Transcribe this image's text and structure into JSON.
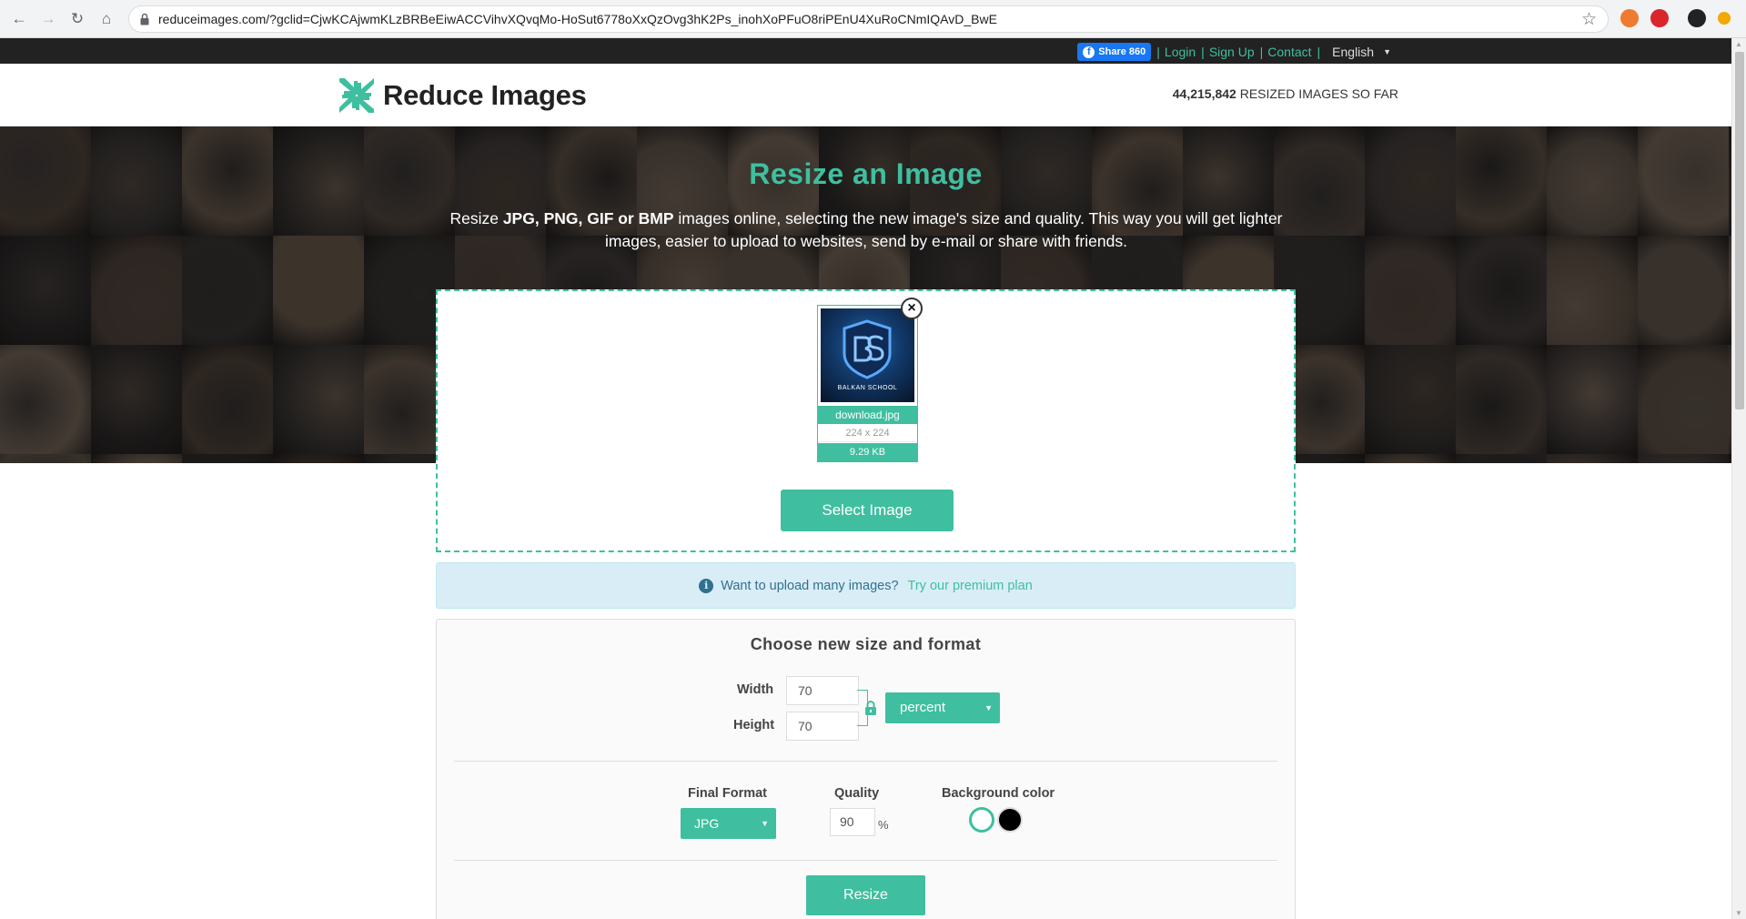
{
  "browser": {
    "url": "reduceimages.com/?gclid=CjwKCAjwmKLzBRBeEiwACCVihvXQvqMo-HoSut6778oXxQzOvg3hK2Ps_inohXoPFuO8riPEnU4XuRoCNmIQAvD_BwE",
    "icons": [
      "back-icon",
      "forward-icon",
      "reload-icon",
      "home-icon",
      "lock-icon",
      "star-icon"
    ]
  },
  "topbar": {
    "share_label": "Share 860",
    "login": "Login",
    "signup": "Sign Up",
    "contact": "Contact",
    "language": "English"
  },
  "header": {
    "logo_text": "Reduce Images",
    "counter_value": "44,215,842",
    "counter_suffix": " RESIZED IMAGES SO FAR"
  },
  "hero": {
    "title": "Resize an Image",
    "desc_1": "Resize ",
    "desc_formats": "JPG, PNG, GIF or BMP",
    "desc_2": " images online, selecting the new image's size and quality. This way you will get lighter images, easier to upload to websites, send by e-mail or share with friends."
  },
  "upload": {
    "file_name": "download.jpg",
    "dimensions": "224 x 224",
    "file_size": "9.29 KB",
    "thumb_caption": "BALKAN SCHOOL",
    "close_symbol": "×",
    "select_label": "Select Image"
  },
  "info": {
    "text": "Want to upload many images?",
    "link": "Try our premium plan"
  },
  "options": {
    "title": "Choose new size and format",
    "width_label": "Width",
    "width_value": "70",
    "height_label": "Height",
    "height_value": "70",
    "unit": "percent",
    "format_label": "Final Format",
    "format": "JPG",
    "quality_label": "Quality",
    "quality_value": "90",
    "quality_unit": "%",
    "bg_label": "Background color",
    "bg_colors": [
      "#ffffff",
      "#000000"
    ],
    "resize_label": "Resize"
  },
  "colors": {
    "accent": "#3fbf9f",
    "topbar": "#222222",
    "info_bg": "#d9edf7"
  }
}
